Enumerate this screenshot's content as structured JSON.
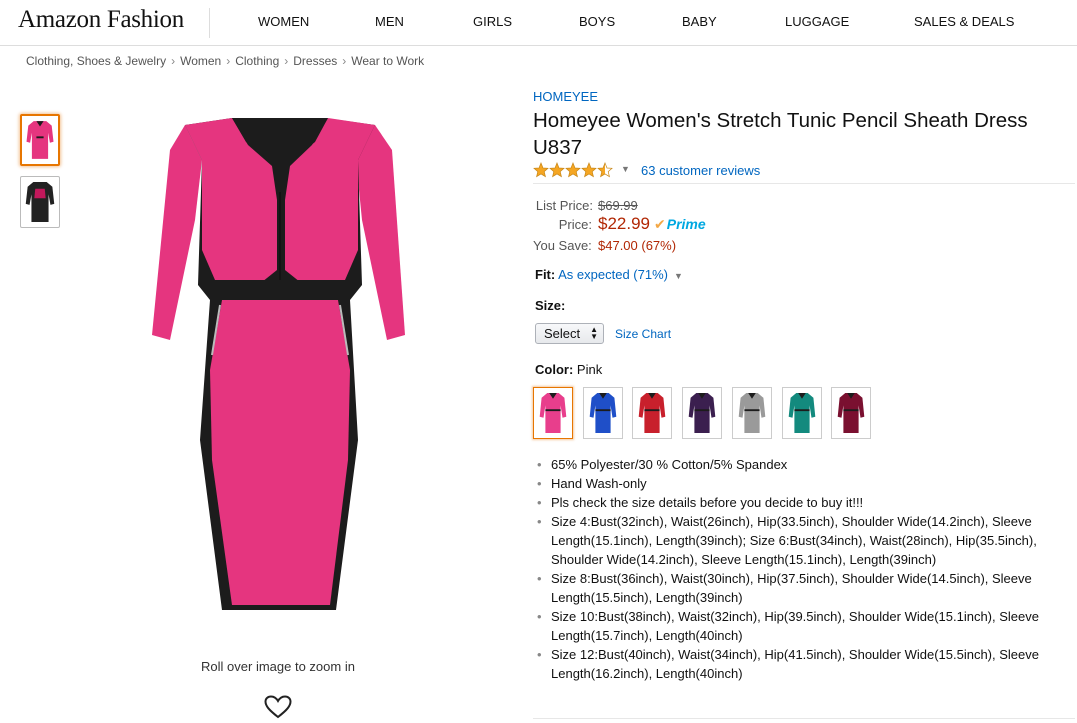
{
  "header": {
    "logo": "Amazon Fashion",
    "nav": [
      "WOMEN",
      "MEN",
      "GIRLS",
      "BOYS",
      "BABY",
      "LUGGAGE",
      "SALES & DEALS"
    ]
  },
  "breadcrumb": [
    "Clothing, Shoes & Jewelry",
    "Women",
    "Clothing",
    "Dresses",
    "Wear to Work"
  ],
  "gallery": {
    "thumbnails": [
      {
        "color": "pink",
        "selected": true
      },
      {
        "color": "black",
        "selected": false
      }
    ],
    "zoom_hint": "Roll over image to zoom in",
    "wishlist_icon": "heart-icon"
  },
  "product": {
    "brand": "HOMEYEE",
    "title": "Homeyee Women's Stretch Tunic Pencil Sheath Dress U837",
    "rating": 4.5,
    "review_link": "63 customer reviews",
    "price": {
      "list_label": "List Price:",
      "list_value": "$69.99",
      "price_label": "Price:",
      "price_value": "$22.99",
      "prime_label": "Prime",
      "save_label": "You Save:",
      "save_value": "$47.00 (67%)"
    },
    "fit": {
      "label": "Fit:",
      "value": "As expected (71%)"
    },
    "size": {
      "label": "Size:",
      "selected": "Select",
      "chart_link": "Size Chart"
    },
    "color": {
      "label": "Color:",
      "selected": "Pink",
      "swatches": [
        {
          "name": "pink",
          "hex": "#e83e8c"
        },
        {
          "name": "blue",
          "hex": "#1f4fc8"
        },
        {
          "name": "red",
          "hex": "#c8202c"
        },
        {
          "name": "purple",
          "hex": "#3b1f4f"
        },
        {
          "name": "grey",
          "hex": "#9a9a9a"
        },
        {
          "name": "teal",
          "hex": "#138a7e"
        },
        {
          "name": "burgundy",
          "hex": "#7a1030"
        }
      ]
    },
    "bullets": [
      "65% Polyester/30 % Cotton/5% Spandex",
      "Hand Wash-only",
      "Pls check the size details before you decide to buy it!!!",
      "Size 4:Bust(32inch), Waist(26inch), Hip(33.5inch), Shoulder Wide(14.2inch), Sleeve Length(15.1inch), Length(39inch); Size 6:Bust(34inch), Waist(28inch), Hip(35.5inch), Shoulder Wide(14.2inch), Sleeve Length(15.1inch), Length(39inch)",
      "Size 8:Bust(36inch), Waist(30inch), Hip(37.5inch), Shoulder Wide(14.5inch), Sleeve Length(15.5inch), Length(39inch)",
      "Size 10:Bust(38inch), Waist(32inch), Hip(39.5inch), Shoulder Wide(15.1inch), Sleeve Length(15.7inch), Length(40inch)",
      "Size 12:Bust(40inch), Waist(34inch), Hip(41.5inch), Shoulder Wide(15.5inch), Sleeve Length(16.2inch), Length(40inch)"
    ]
  },
  "colors": {
    "link": "#0066c0",
    "price": "#b12704",
    "prime": "#00a8e1",
    "accent": "#e77600",
    "dress_pink": "#e5357f",
    "dress_black": "#1c1c1c"
  }
}
